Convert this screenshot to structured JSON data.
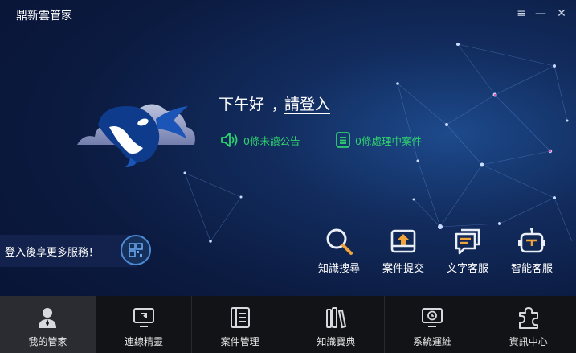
{
  "app": {
    "title": "鼎新雲管家"
  },
  "window_controls": {
    "menu": "≡",
    "minimize": "—",
    "close": "✕"
  },
  "greeting": {
    "text": "下午好",
    "separator": "，",
    "login_link": "請登入"
  },
  "notices": [
    {
      "label": "0條未讀公告",
      "icon": "speaker-icon"
    },
    {
      "label": "0條處理中案件",
      "icon": "list-icon"
    }
  ],
  "promo": {
    "text": "登入後享更多服務！",
    "icon": "qr-code-icon"
  },
  "quick_actions": [
    {
      "label": "知識搜尋",
      "icon": "magnifier-icon"
    },
    {
      "label": "案件提交",
      "icon": "upload-tray-icon"
    },
    {
      "label": "文字客服",
      "icon": "chat-bubble-icon"
    },
    {
      "label": "智能客服",
      "icon": "robot-icon"
    }
  ],
  "nav": {
    "active": "我的管家",
    "items": [
      {
        "label": "我的管家",
        "icon": "user-icon"
      },
      {
        "label": "連線精靈",
        "icon": "remote-monitor-icon"
      },
      {
        "label": "案件管理",
        "icon": "document-list-icon"
      },
      {
        "label": "知識寶典",
        "icon": "books-icon"
      },
      {
        "label": "系統運維",
        "icon": "monitor-clock-icon"
      },
      {
        "label": "資訊中心",
        "icon": "puzzle-icon"
      }
    ]
  },
  "colors": {
    "accent_green": "#2fd16e",
    "nav_bg": "#111316",
    "active_nav_bg": "#2a2c31"
  }
}
